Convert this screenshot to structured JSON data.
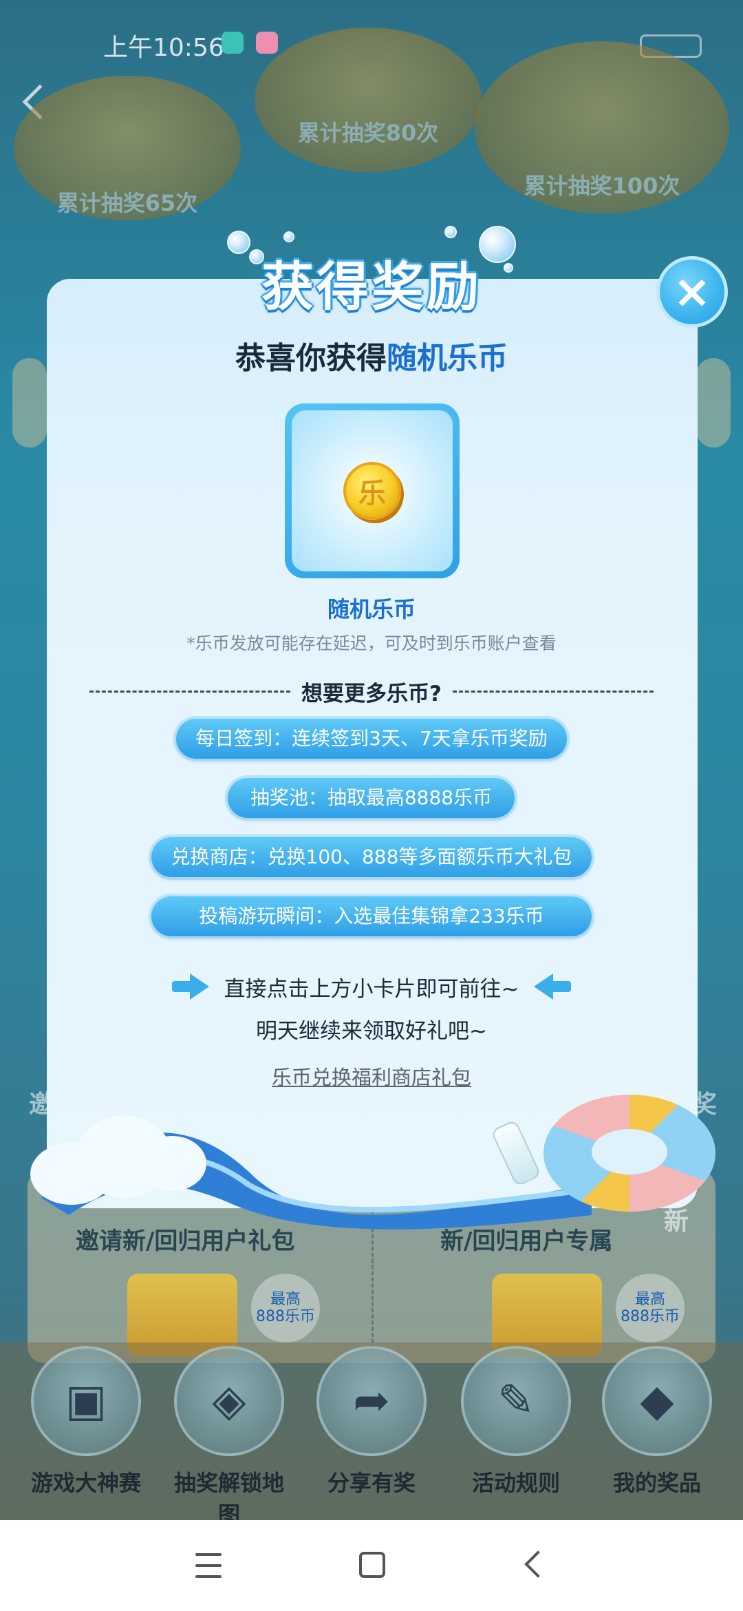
{
  "status_bar": {
    "time": "上午10:56"
  },
  "background": {
    "islands": [
      {
        "label": "累计抽奖65次"
      },
      {
        "label": "累计抽奖80次"
      },
      {
        "label": "累计抽奖100次"
      }
    ],
    "gift_panels": [
      {
        "title": "邀请新/回归用户礼包",
        "badge_top": "最高",
        "badge_bottom": "888乐币"
      },
      {
        "title": "新/回归用户专属",
        "badge_top": "最高",
        "badge_bottom": "888乐币"
      }
    ],
    "bottom_nav": [
      {
        "label": "游戏大神赛",
        "icon": "tv-icon"
      },
      {
        "label": "抽奖解锁地图",
        "icon": "map-icon"
      },
      {
        "label": "分享有奖",
        "icon": "share-icon"
      },
      {
        "label": "活动规则",
        "icon": "book-icon"
      },
      {
        "label": "我的奖品",
        "icon": "gift-icon"
      }
    ],
    "side_text_left": "邀",
    "side_text_right": "奖",
    "new_tag": "新"
  },
  "modal": {
    "title": "获得奖励",
    "congrats_prefix": "恭喜你获得",
    "congrats_highlight": "随机乐币",
    "coin_glyph": "乐",
    "prize_name": "随机乐币",
    "prize_note": "*乐币发放可能存在延迟，可及时到乐币账户查看",
    "more_title": "想要更多乐币?",
    "tasks": [
      "每日签到：连续签到3天、7天拿乐币奖励",
      "抽奖池：抽取最高8888乐币",
      "兑换商店：兑换100、888等多面额乐币大礼包",
      "投稿游玩瞬间：入选最佳集锦拿233乐币"
    ],
    "hint": "直接点击上方小卡片即可前往~",
    "tomorrow": "明天继续来领取好礼吧~",
    "shop_link": "乐币兑换福利商店礼包",
    "close_glyph": "×"
  },
  "colors": {
    "accent_blue": "#1a6fd0",
    "pill_blue": "#2f9ee6",
    "modal_bg": "#e4f4fd"
  }
}
